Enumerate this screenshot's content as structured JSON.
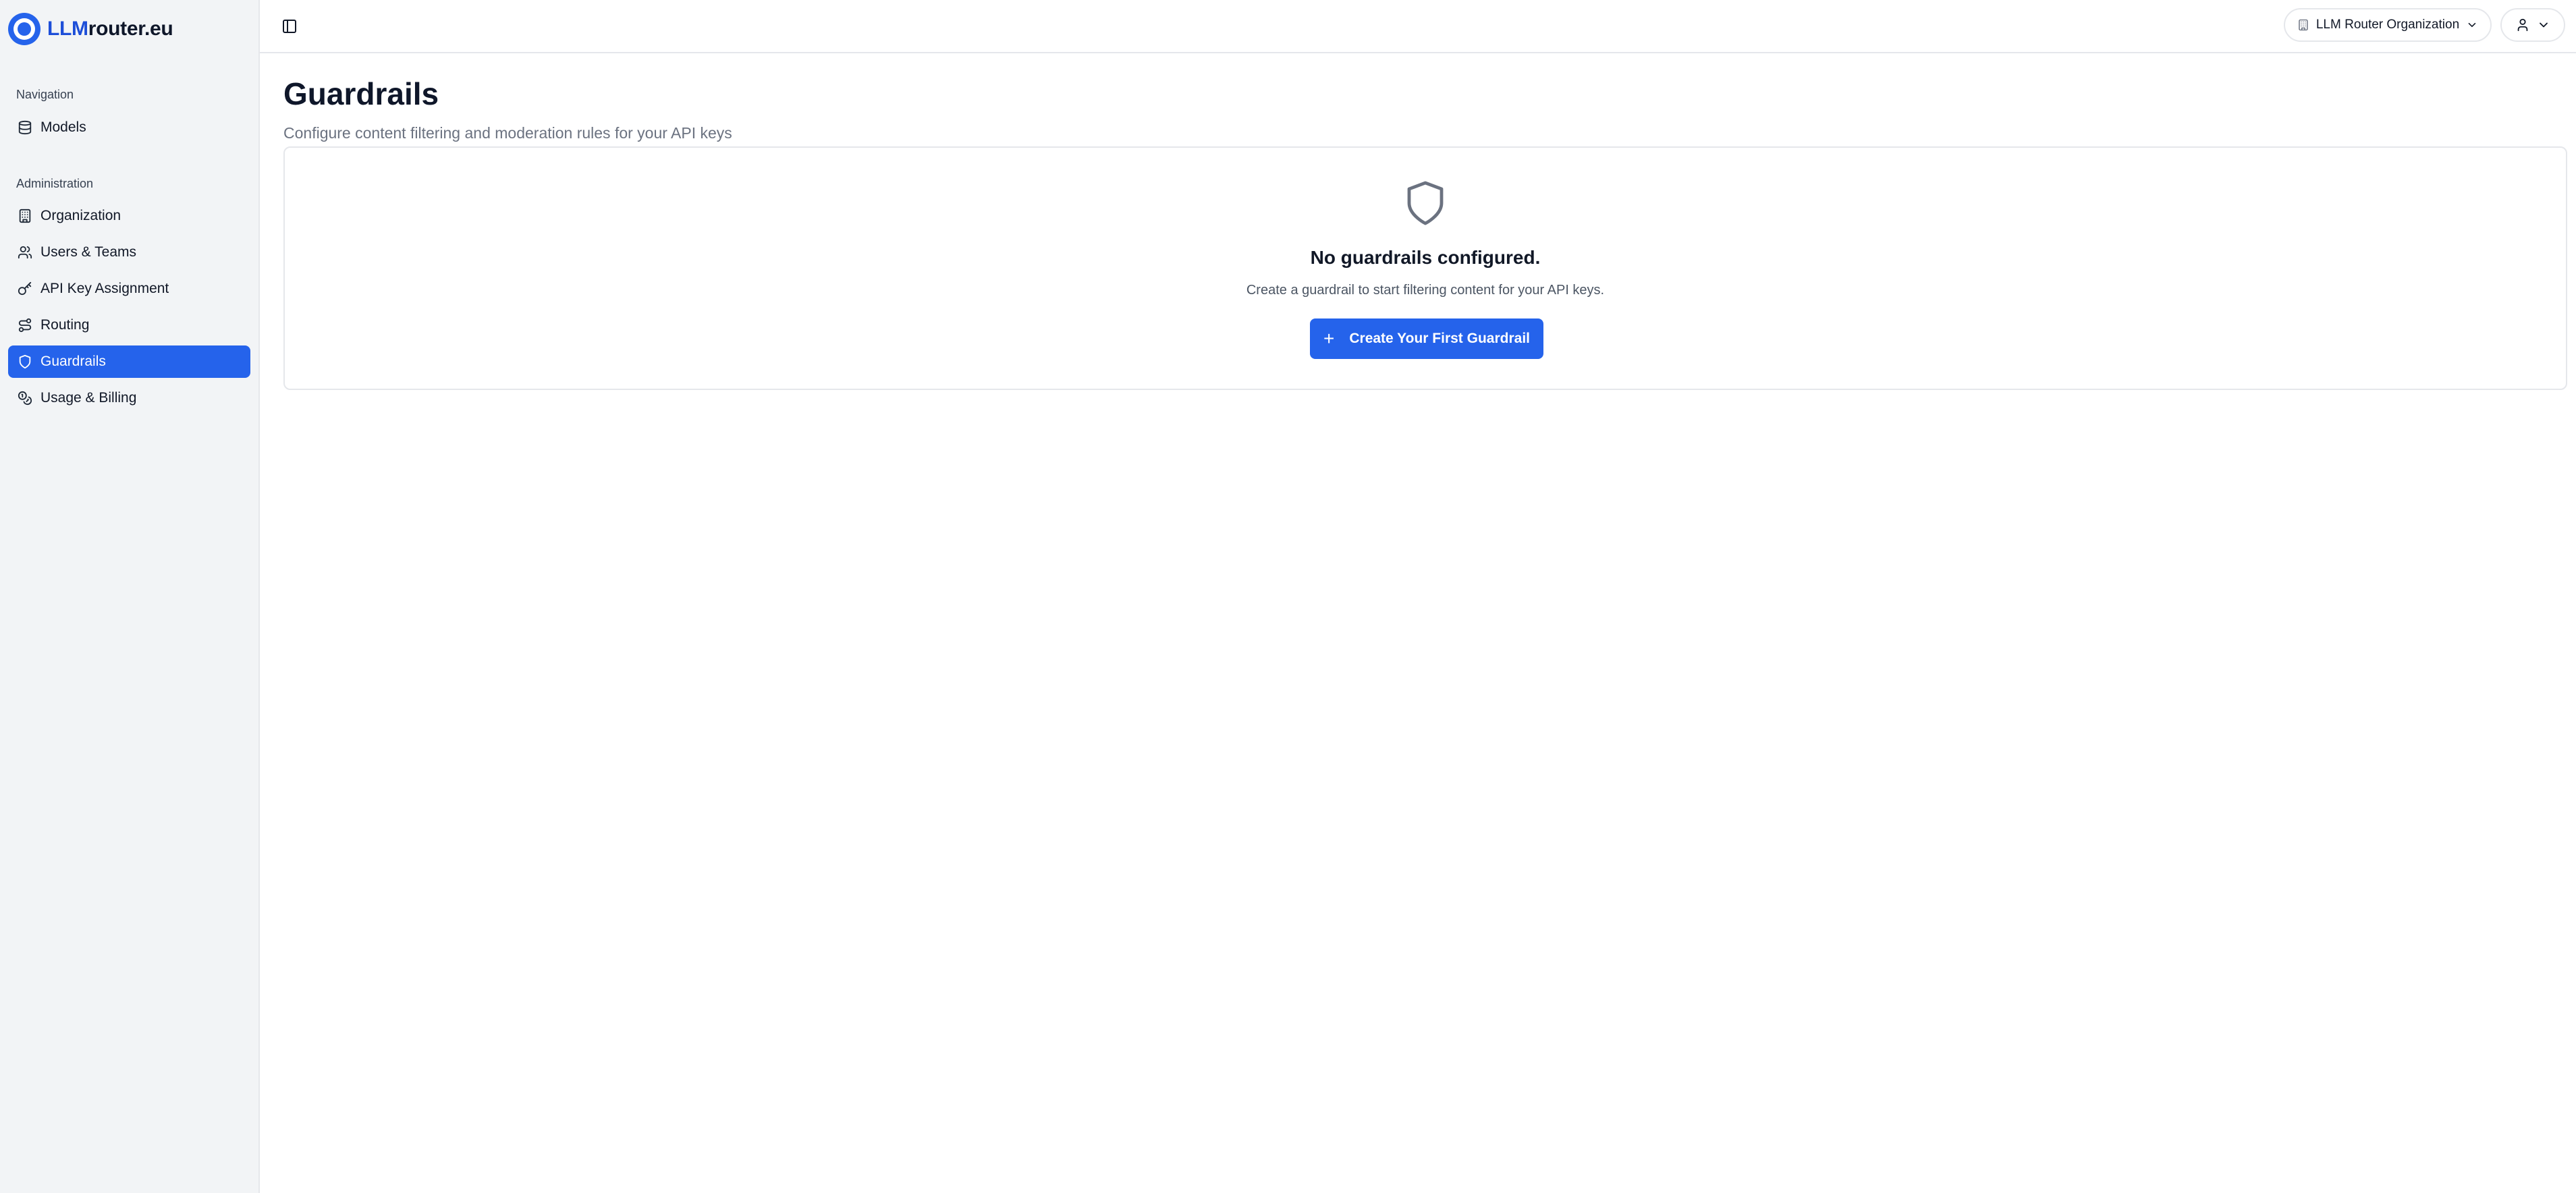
{
  "brand": {
    "name_accent": "LLM",
    "name_rest": "router.eu"
  },
  "sidebar": {
    "sections": [
      {
        "label": "Navigation"
      },
      {
        "label": "Administration"
      }
    ],
    "items": [
      {
        "label": "Models",
        "icon": "database-icon"
      },
      {
        "label": "Organization",
        "icon": "building-icon"
      },
      {
        "label": "Users & Teams",
        "icon": "users-icon"
      },
      {
        "label": "API Key Assignment",
        "icon": "key-icon"
      },
      {
        "label": "Routing",
        "icon": "route-icon"
      },
      {
        "label": "Guardrails",
        "icon": "shield-icon",
        "active": true
      },
      {
        "label": "Usage & Billing",
        "icon": "coins-icon"
      }
    ]
  },
  "topbar": {
    "toggle_icon": "sidebar-toggle-icon",
    "org_select": {
      "value": "LLM Router Organization",
      "icon": "building-icon"
    },
    "user_menu": {
      "icon": "user-icon"
    }
  },
  "page": {
    "title": "Guardrails",
    "subtitle": "Configure content filtering and moderation rules for your API keys"
  },
  "empty_state": {
    "icon": "shield-icon",
    "title": "No guardrails configured.",
    "description": "Create a guardrail to start filtering content for your API keys.",
    "button_label": "Create Your First Guardrail",
    "button_icon": "plus-icon"
  },
  "colors": {
    "accent": "#2563eb",
    "sidebar_bg": "#f2f4f6",
    "border": "#e5e7eb",
    "text_primary": "#0f172a",
    "text_muted": "#6b7280"
  }
}
